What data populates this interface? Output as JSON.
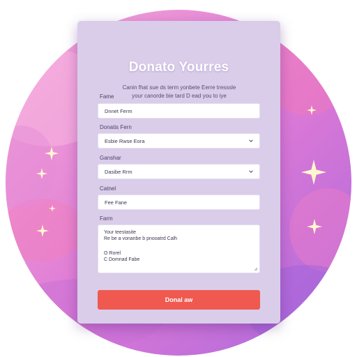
{
  "colors": {
    "card_background": "#d9cdea",
    "button": "#f0594f",
    "title": "#ffffff",
    "backdrop_light": "#f3a6d6",
    "backdrop_dark": "#b36fe0"
  },
  "card": {
    "title": "Donato Yourres",
    "subtitle_line1": "Canin fhat sue ds term yonbete Eerre tresssle",
    "subtitle_line2": "your canorde bie tard D ead you to iye"
  },
  "form": {
    "field1": {
      "label": "Fame",
      "value": "Dnnet Ferm"
    },
    "field2": {
      "label": "Donatis Fern",
      "value": "Esbie Rwse Eora",
      "icon": "chevron-down-icon"
    },
    "field3": {
      "label": "Ganshar",
      "value": "Dasibe Rrm",
      "icon": "chevron-down-icon"
    },
    "field4": {
      "label": "Catnel",
      "value": "Fee Fane"
    },
    "message": {
      "label": "Farm",
      "line1": "Your teestasite",
      "line2": "Re be a vonanbe b pnooatrd Calh",
      "line3": "O Rorel",
      "line4": "C Domnad Fabe"
    },
    "submit_label": "Donal aw"
  },
  "decor": {
    "sparkle_icon": "sparkle-icon"
  }
}
